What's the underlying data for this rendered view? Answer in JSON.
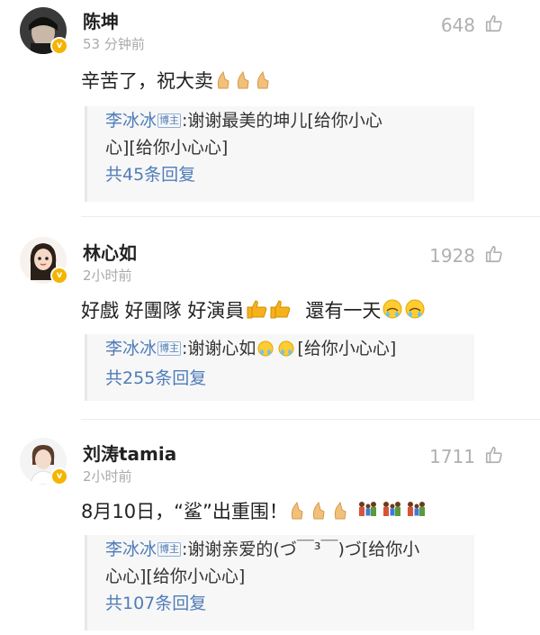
{
  "comments": [
    {
      "name": "陈坤",
      "time": "53 分钟前",
      "likes": "648",
      "text": "辛苦了，祝大卖",
      "reply": {
        "user": "李冰冰",
        "badge": "博主",
        "line1": ":谢谢最美的坤儿[给你小心",
        "line2": "心][给你小心心]",
        "count": "共45条回复"
      }
    },
    {
      "name": "林心如",
      "time": "2小时前",
      "likes": "1928",
      "text_a": "好戲 好團隊 好演員",
      "text_b": "還有一天",
      "reply": {
        "user": "李冰冰",
        "badge": "博主",
        "line1a": ":谢谢心如",
        "line1b": "[给你小心心]",
        "count": "共255条回复"
      }
    },
    {
      "name": "刘涛tamia",
      "time": "2小时前",
      "likes": "1711",
      "text": "8月10日，“鲨”出重围！",
      "reply": {
        "user": "李冰冰",
        "badge": "博主",
        "line1": ":谢谢亲爱的(づ￣³￣)づ[给你小",
        "line2": "心心][给你小心心]",
        "count": "共107条回复"
      }
    }
  ],
  "colors": {
    "link": "#4f7db8",
    "muted": "#aaaaaa",
    "badge": "#f5b400"
  },
  "icons": [
    "thumbs-up-outline-icon",
    "verified-badge-icon",
    "clapping-hand-emoji",
    "crying-emoji",
    "family-emoji"
  ]
}
